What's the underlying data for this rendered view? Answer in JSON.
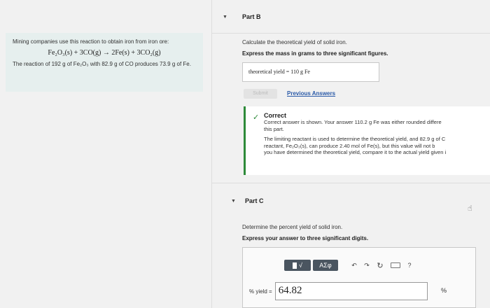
{
  "info": {
    "intro": "Mining companies use this reaction to obtain iron from iron ore:",
    "equation": "Fe₂O₃(s) + 3CO(g) → 2Fe(s) + 3CO₂(g)",
    "reaction_text": "The reaction of 192 g of Fe₂O₃ with 82.9 g of CO produces 73.9 g of Fe."
  },
  "partB": {
    "label": "Part B",
    "instruction": "Calculate the theoretical yield of solid iron.",
    "directive": "Express the mass in grams to three significant figures.",
    "answer_display": "theoretical yield = 110 g Fe",
    "submit_label": "Submit",
    "prev_answers_label": "Previous Answers",
    "feedback": {
      "title": "Correct",
      "line1": "Correct answer is shown. Your answer 110.2 g Fe was either rounded differe",
      "line2": "this part.",
      "line3": "The limiting reactant is used to determine the theoretical yield, and 82.9 g of C",
      "line4": "reactant, Fe₂O₃(s), can produce 2.40 mol of Fe(s), but this value will not b",
      "line5": "you have determined the theoretical yield, compare it to the actual yield given i"
    }
  },
  "partC": {
    "label": "Part C",
    "instruction": "Determine the percent yield of solid iron.",
    "directive": "Express your answer to three significant digits.",
    "yield_label": "% yield =",
    "yield_value": "64.82",
    "unit": "%",
    "toolbar": {
      "templates_symbol": "√",
      "greek_label": "ΑΣφ",
      "help_symbol": "?"
    }
  }
}
